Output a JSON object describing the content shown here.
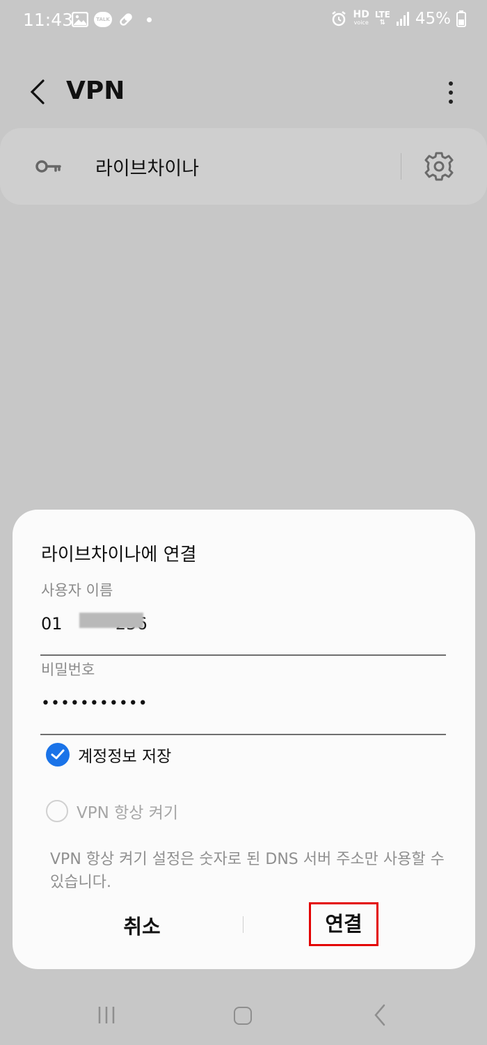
{
  "status_bar": {
    "time": "11:43",
    "hd_label": "HD",
    "voice_label": "voice",
    "lte_label": "LTE",
    "battery": "45%",
    "icons": [
      "gallery-icon",
      "talk-icon",
      "pill-icon",
      "dot-icon",
      "alarm-icon",
      "signal-icon",
      "battery-icon"
    ],
    "talk_label": "TALK"
  },
  "header": {
    "title": "VPN"
  },
  "vpn_list": {
    "items": [
      {
        "name": "라이브차이나"
      }
    ]
  },
  "dialog": {
    "title": "라이브차이나에 연결",
    "username_label": "사용자 이름",
    "username_value": "01          256",
    "password_label": "비밀번호",
    "password_value": "•••••••••••",
    "save_account": {
      "label": "계정정보 저장",
      "checked": true
    },
    "always_on": {
      "label": "VPN 항상 켜기",
      "checked": false
    },
    "note": "VPN 항상 켜기 설정은 숫자로 된 DNS 서버 주소만 사용할 수 있습니다.",
    "cancel_label": "취소",
    "connect_label": "연결"
  },
  "colors": {
    "accent": "#1a73e8",
    "highlight": "#e30000",
    "background": "#c7c7c7",
    "dialog": "#fbfbfb"
  }
}
